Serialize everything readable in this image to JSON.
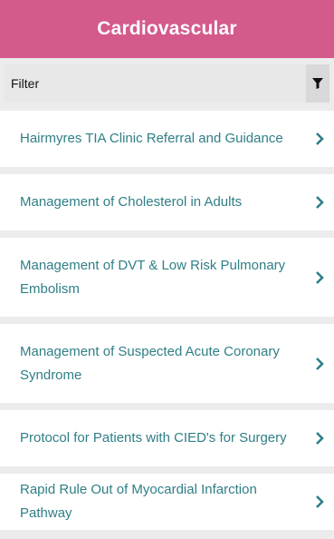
{
  "header": {
    "title": "Cardiovascular"
  },
  "filter": {
    "label": "Filter",
    "icon": "filter-icon"
  },
  "colors": {
    "header_bg": "#d45a8c",
    "link": "#2f7f86"
  },
  "items": [
    {
      "label": "Hairmyres TIA Clinic Referral and Guidance"
    },
    {
      "label": "Management of Cholesterol in Adults"
    },
    {
      "label": "Management of DVT & Low Risk Pulmonary Embolism"
    },
    {
      "label": "Management of Suspected Acute Coronary Syndrome"
    },
    {
      "label": "Protocol for Patients with CIED's for Surgery"
    },
    {
      "label": "Rapid Rule Out of Myocardial Infarction Pathway"
    }
  ]
}
